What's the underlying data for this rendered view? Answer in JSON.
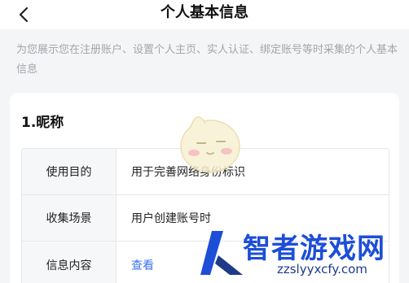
{
  "header": {
    "title": "个人基本信息",
    "back_icon": "chevron-left-icon"
  },
  "intro_text": "为您展示您在注册账户、设置个人主页、实人认证、绑定账号等时采集的个人基本信息",
  "section": {
    "title": "1.昵称",
    "rows": [
      {
        "label": "使用目的",
        "value": "用于完善网络身份标识"
      },
      {
        "label": "收集场景",
        "value": "用户创建账号时"
      },
      {
        "label": "信息内容",
        "value": "查看"
      }
    ]
  },
  "watermark": {
    "brand": "智者游戏网",
    "url": "zzslyyxcfy.com"
  },
  "colors": {
    "link": "#3a72f0",
    "muted_text": "#a3a6ab",
    "page_bg": "#f4f5f7"
  }
}
